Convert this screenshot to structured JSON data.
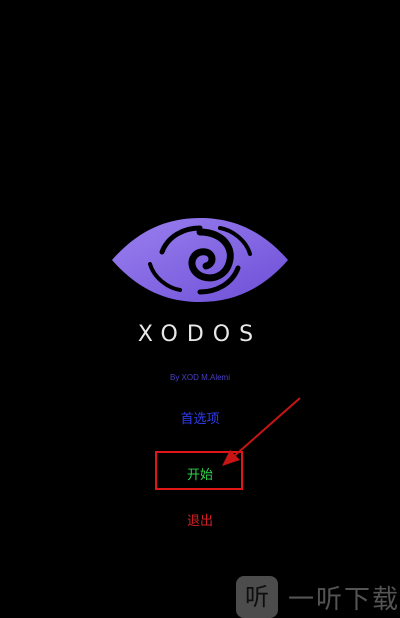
{
  "app": {
    "name": "XODOS",
    "byline": "By XOD M.Alemi",
    "logo_icon": "xodos-eye-logo-icon"
  },
  "menu": {
    "preferences_label": "首选项",
    "start_label": "开始",
    "exit_label": "退出"
  },
  "annotation": {
    "highlight_color": "#e01515",
    "arrow_icon": "arrow-pointer-icon"
  },
  "watermark": {
    "icon_char": "听",
    "text": "一听下载"
  },
  "colors": {
    "background": "#000000",
    "logo_purple": "#8b6fe8",
    "preferences": "#2f3cf0",
    "start": "#32d14a",
    "exit": "#d21f25"
  }
}
